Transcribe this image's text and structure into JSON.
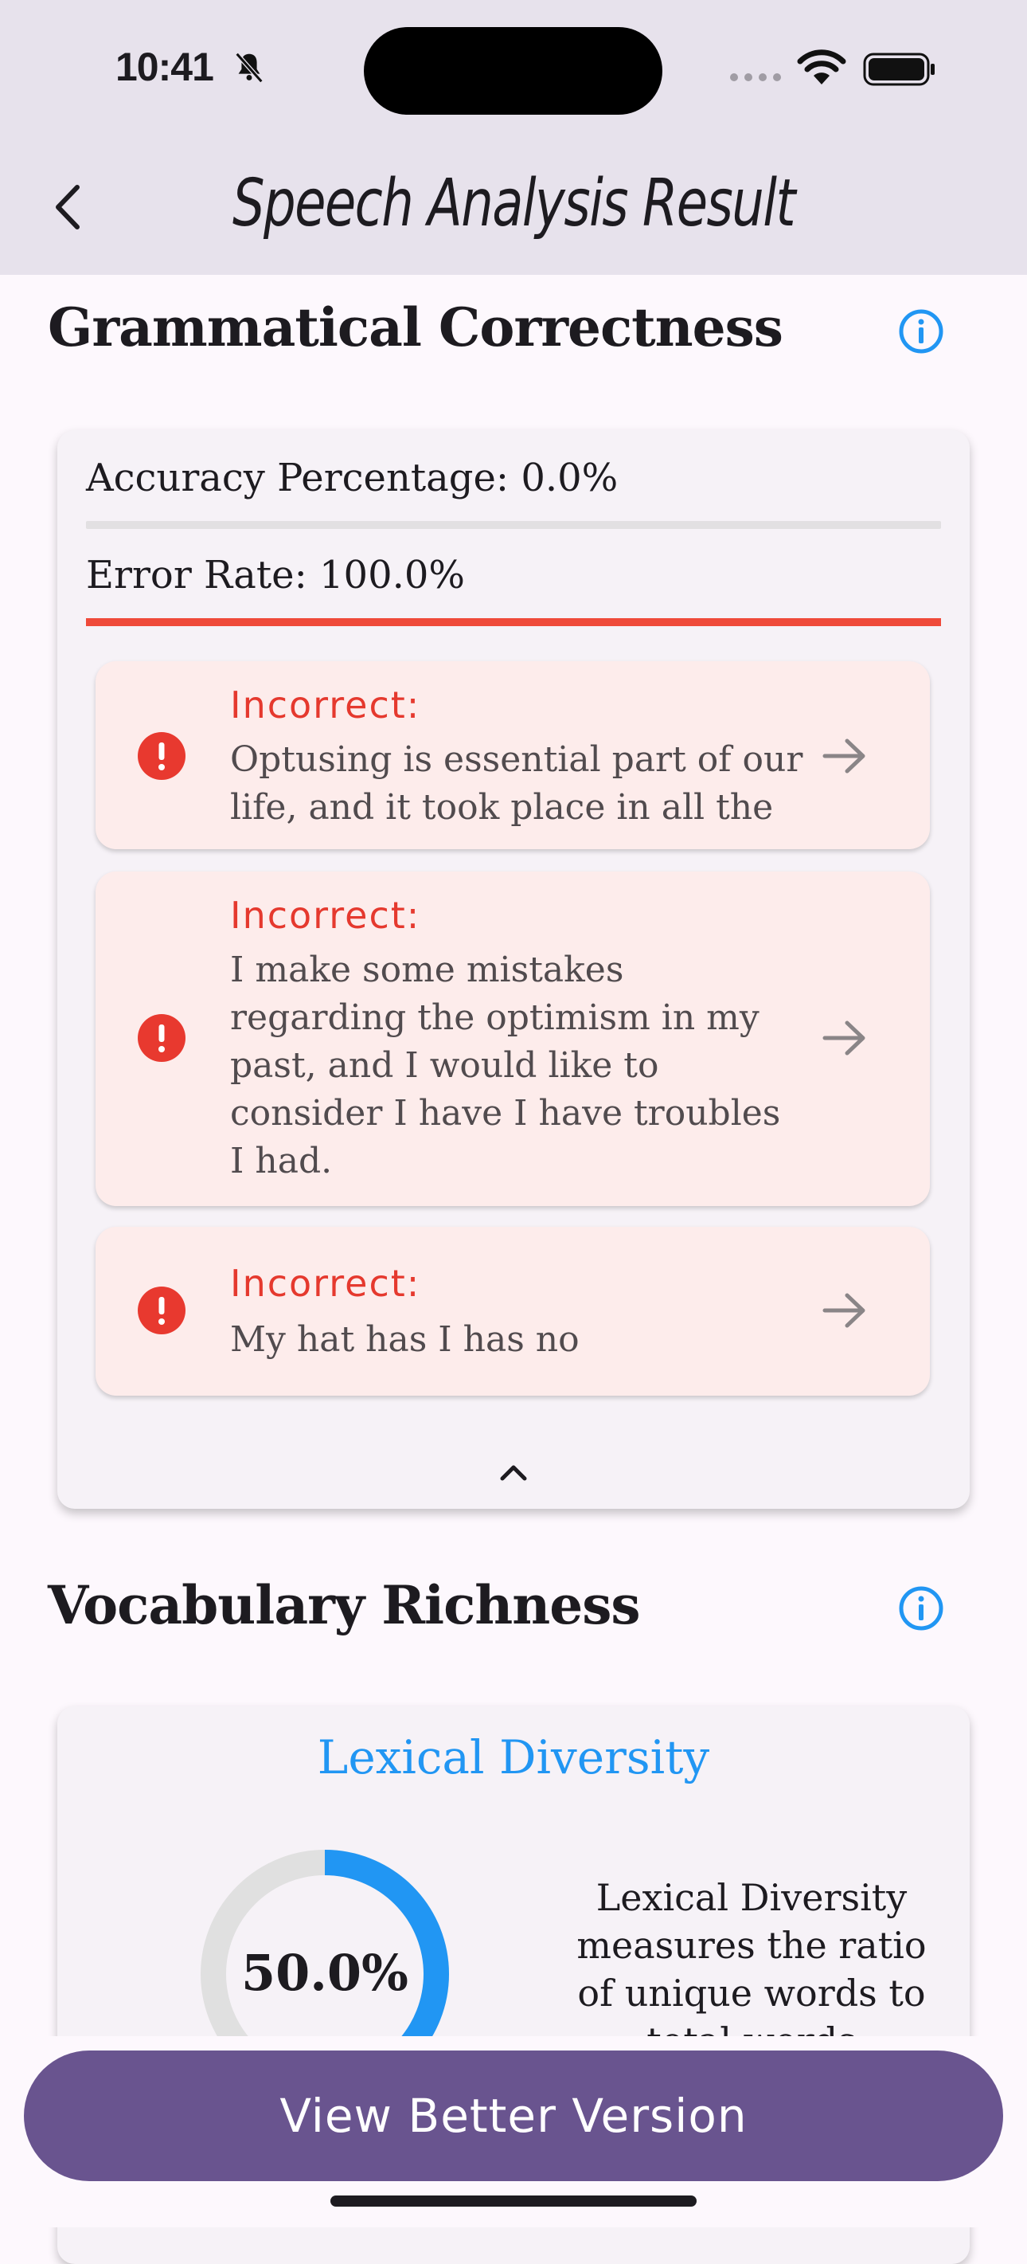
{
  "status_bar": {
    "time": "10:41"
  },
  "header": {
    "title": "Speech Analysis Result"
  },
  "grammar": {
    "title": "Grammatical Correctness",
    "accuracy_label": "Accuracy Percentage: 0.0%",
    "accuracy_fraction": 0.0,
    "error_label": "Error Rate: 100.0%",
    "error_fraction": 1.0,
    "errors": [
      {
        "label": "Incorrect:",
        "text": "Optusing is essential part of our life, and it took place in all the"
      },
      {
        "label": "Incorrect:",
        "text": "I make some mistakes regarding the optimism in my past, and I would like to consider  I have I have troubles I had."
      },
      {
        "label": "Incorrect:",
        "text": "My hat has I has no"
      }
    ]
  },
  "vocabulary": {
    "title": "Vocabulary Richness",
    "lexical_title": "Lexical Diversity",
    "lexical_value_label": "50.0%",
    "lexical_fraction": 0.5,
    "lexical_description": "Lexical Diversity measures the ratio of unique words to total words"
  },
  "actions": {
    "view_better": "View Better Version"
  },
  "colors": {
    "accent_blue": "#2196f3",
    "error_red": "#e5392e",
    "primary_purple": "#69548f"
  }
}
